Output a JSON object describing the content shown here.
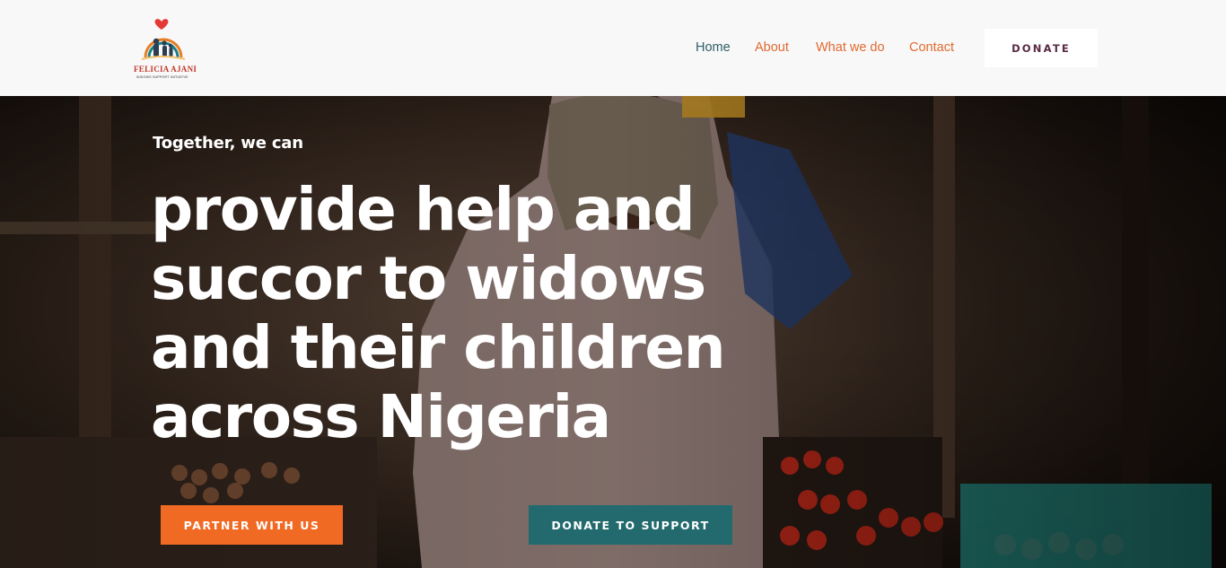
{
  "brand": {
    "name": "FELICIA AJANI",
    "tagline": "WIDOWS SUPPORT INITIATIVE"
  },
  "nav": {
    "items": [
      {
        "label": "Home",
        "active": true
      },
      {
        "label": "About",
        "active": false
      },
      {
        "label": "What we do",
        "active": false
      },
      {
        "label": "Contact",
        "active": false
      }
    ],
    "donate_label": "DONATE"
  },
  "hero": {
    "eyebrow": "Together, we can",
    "headline_lines": [
      "provide help and",
      "succor to widows",
      "and their children",
      "across Nigeria"
    ],
    "partner_label": "PARTNER WITH US",
    "support_label": "DONATE TO SUPPORT"
  },
  "colors": {
    "header_bg": "#f8f8f8",
    "nav_link": "#e06a2f",
    "nav_active": "#2f5f66",
    "donate_text": "#5a2a44",
    "partner_btn": "#f06a24",
    "support_btn": "#236a6f"
  }
}
